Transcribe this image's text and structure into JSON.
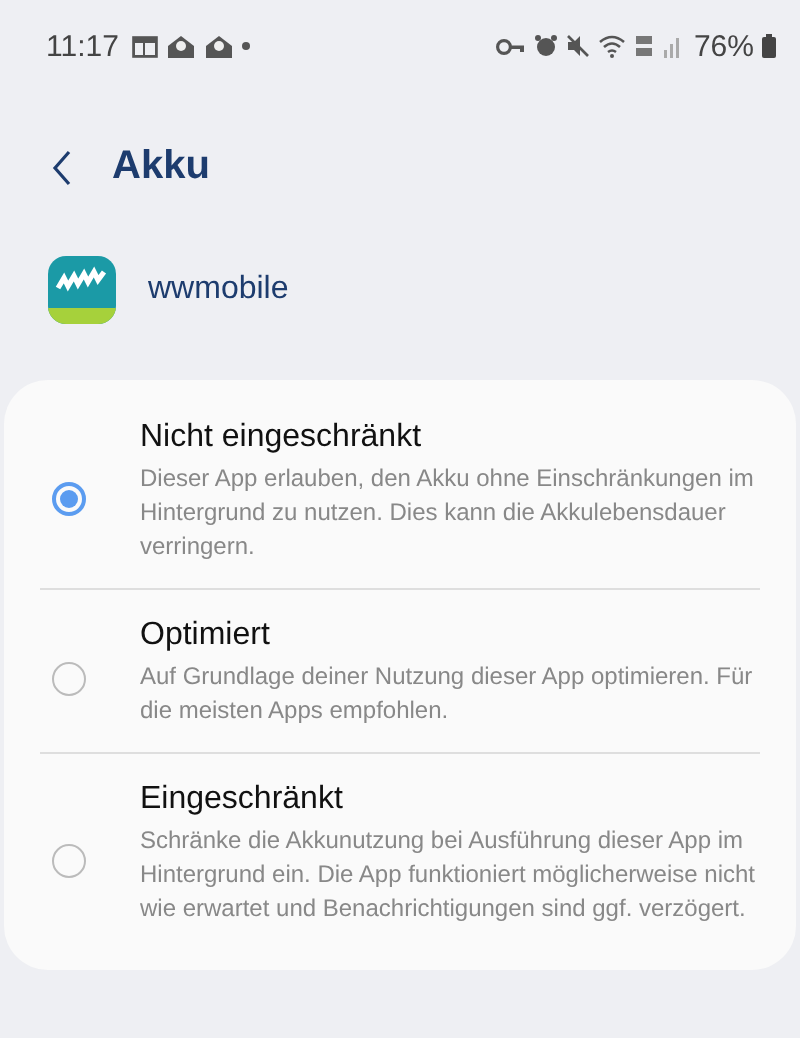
{
  "status_bar": {
    "time": "11:17",
    "battery": "76%"
  },
  "header": {
    "title": "Akku"
  },
  "app": {
    "name": "wwmobile"
  },
  "options": [
    {
      "title": "Nicht eingeschränkt",
      "description": "Dieser App erlauben, den Akku ohne Einschränkungen im Hintergrund zu nutzen. Dies kann die Akkulebensdauer verringern.",
      "selected": true
    },
    {
      "title": "Optimiert",
      "description": "Auf Grundlage deiner Nutzung dieser App optimieren. Für die meisten Apps empfohlen.",
      "selected": false
    },
    {
      "title": "Eingeschränkt",
      "description": "Schränke die Akkunutzung bei Ausführung dieser App im Hintergrund ein. Die App funktioniert möglicherweise nicht wie erwartet und Benachrichtigungen sind ggf. verzögert.",
      "selected": false
    }
  ]
}
